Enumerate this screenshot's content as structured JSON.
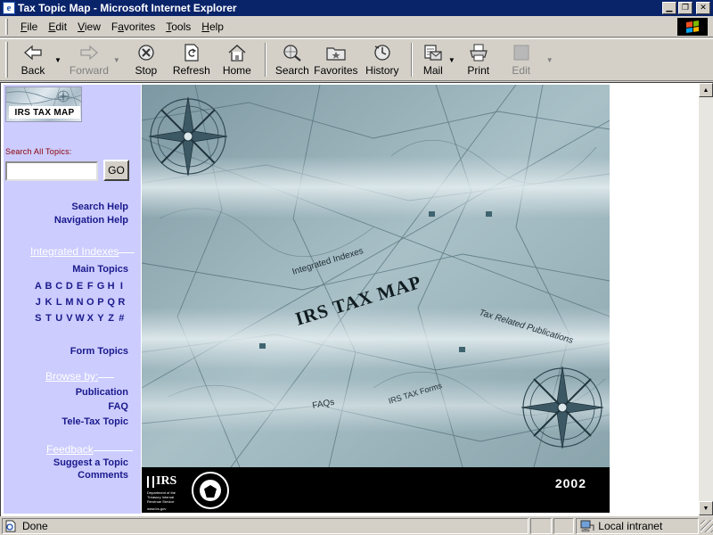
{
  "window": {
    "title": "Tax Topic Map - Microsoft Internet Explorer",
    "controls": [
      "minimize",
      "restore",
      "close"
    ]
  },
  "menubar": {
    "items": [
      {
        "label": "File",
        "mnemonic": "F"
      },
      {
        "label": "Edit",
        "mnemonic": "E"
      },
      {
        "label": "View",
        "mnemonic": "V"
      },
      {
        "label": "Favorites",
        "mnemonic": "a"
      },
      {
        "label": "Tools",
        "mnemonic": "T"
      },
      {
        "label": "Help",
        "mnemonic": "H"
      }
    ]
  },
  "toolbar": {
    "back": "Back",
    "forward": "Forward",
    "stop": "Stop",
    "refresh": "Refresh",
    "home": "Home",
    "search": "Search",
    "favorites": "Favorites",
    "history": "History",
    "mail": "Mail",
    "print": "Print",
    "edit": "Edit"
  },
  "sidebar": {
    "logo_text": "IRS TAX MAP",
    "search_label": "Search All Topics:",
    "search_value": "",
    "go_label": "GO",
    "search_help": "Search Help",
    "navigation_help": "Navigation Help",
    "integrated_indexes_heading": "Integrated Indexes",
    "main_topics": "Main Topics",
    "alpha_rows": [
      [
        "A",
        "B",
        "C",
        "D",
        "E",
        "F",
        "G",
        "H",
        "I"
      ],
      [
        "J",
        "K",
        "L",
        "M",
        "N",
        "O",
        "P",
        "Q",
        "R"
      ],
      [
        "S",
        "T",
        "U",
        "V",
        "W",
        "X",
        "Y",
        "Z",
        "#"
      ]
    ],
    "form_topics": "Form Topics",
    "browse_by_heading": "Browse by:",
    "publication": "Publication",
    "faq": "FAQ",
    "tele_tax_topic": "Tele-Tax Topic",
    "feedback_heading": "Feedback",
    "suggest_topic": "Suggest a Topic",
    "comments": "Comments"
  },
  "map": {
    "title": "IRS TAX MAP",
    "label_integrated": "Integrated Indexes",
    "label_publications": "Tax Related Publications",
    "label_faqs": "FAQs",
    "label_forms": "IRS TAX Forms",
    "footer_agency": "IRS",
    "footer_agency_sub": "Department of the Treasury Internal Revenue Service",
    "footer_url": "www.irs.gov",
    "year": "2002"
  },
  "statusbar": {
    "status": "Done",
    "zone": "Local intranet"
  }
}
